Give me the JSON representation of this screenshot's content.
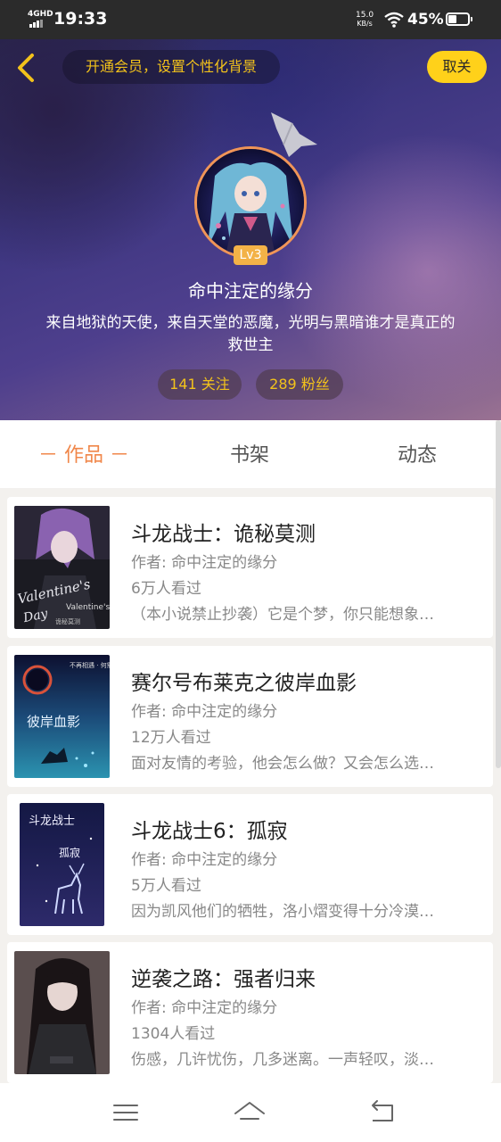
{
  "status_bar": {
    "network": "4GHD",
    "time": "19:33",
    "speed_value": "15.0",
    "speed_unit": "KB/s",
    "battery_percent": "45%",
    "icons": [
      "signal-icon",
      "wifi-icon",
      "battery-icon"
    ]
  },
  "header": {
    "back_icon": "chevron-left-icon",
    "vip_prompt": "开通会员，设置个性化背景",
    "unfollow_label": "取关",
    "level": "Lv3",
    "username": "命中注定的缘分",
    "bio_line1": "来自地狱的天使，来自天堂的恶魔，光明与黑暗谁才是真正的",
    "bio_line2": "救世主",
    "following": "141 关注",
    "fans": "289 粉丝"
  },
  "tabs": [
    {
      "label": "－ 作品 －",
      "active": true
    },
    {
      "label": "书架",
      "active": false
    },
    {
      "label": "动态",
      "active": false
    }
  ],
  "books": [
    {
      "title": "斗龙战士：诡秘莫测",
      "author": "作者: 命中注定的缘分",
      "views": "6万人看过",
      "desc": "（本小说禁止抄袭）它是个梦，你只能想象…",
      "cover_text": "Valentine's Day 斗龙战士",
      "cover_subtext": "诡秘莫测"
    },
    {
      "title": "赛尔号布莱克之彼岸血影",
      "author": "作者: 命中注定的缘分",
      "views": "12万人看过",
      "desc": "面对友情的考验，他会怎么做？又会怎么选…",
      "cover_text": "彼岸血影",
      "cover_subtext": "不再相遇 · 何需制表"
    },
    {
      "title": "斗龙战士6：孤寂",
      "author": "作者: 命中注定的缘分",
      "views": "5万人看过",
      "desc": "因为凯风他们的牺牲，洛小熠变得十分冷漠…",
      "cover_text": "斗龙战士",
      "cover_subtext": "孤寂"
    },
    {
      "title": "逆袭之路：强者归来",
      "author": "作者: 命中注定的缘分",
      "views": "1304人看过",
      "desc": "伤感，几许忧伤，几多迷离。一声轻叹，淡…",
      "cover_text": "",
      "cover_subtext": ""
    }
  ],
  "navbar": {
    "icons": [
      "menu-icon",
      "home-icon",
      "back-icon"
    ]
  },
  "colors": {
    "accent": "#f0874a",
    "vip_gold": "#f2c21b",
    "unfollow_bg": "#ffd11a",
    "level_badge": "#f3b247"
  }
}
